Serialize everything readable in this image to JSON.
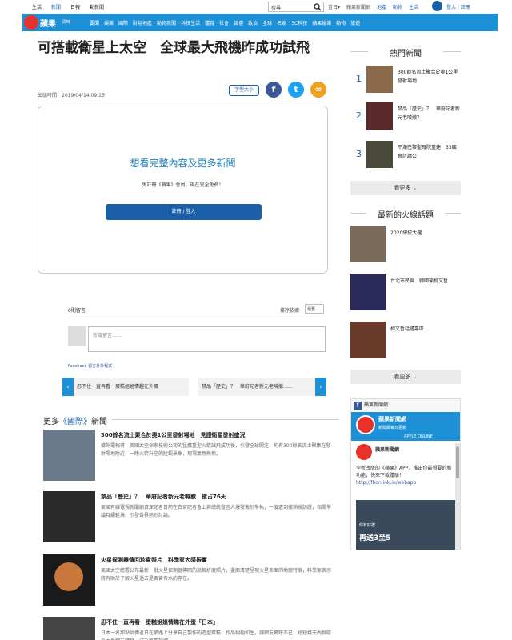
{
  "topbar": {
    "left_links": [
      "生活",
      "新聞",
      "日報",
      "動新聞"
    ],
    "search_placeholder": "搜尋",
    "right_links": [
      {
        "label": "昔日▾",
        "color": "gray"
      },
      {
        "label": "蘋果新聞網",
        "color": "gray"
      },
      {
        "label": "地產",
        "color": "blue"
      },
      {
        "label": "動物",
        "color": "blue"
      },
      {
        "label": "生活",
        "color": "blue"
      }
    ],
    "login": "登入 | 註冊"
  },
  "navbar": {
    "logo": "蘋果",
    "logo_sub": "即時",
    "items": [
      "要聞",
      "娛樂",
      "國際",
      "財經地產",
      "動物新聞",
      "科技生活",
      "體育",
      "社會",
      "論壇",
      "政治",
      "全球",
      "名家",
      "3C科技",
      "蘋果娛樂",
      "動物",
      "旅遊"
    ]
  },
  "article": {
    "title": "可搭載衛星上太空　全球最大飛機昨成功試飛",
    "pubdate": "出版時間：2019/04/14 09:15",
    "font_button": "字型大小",
    "share_icons": [
      "facebook-icon",
      "twitter-icon",
      "link-icon"
    ]
  },
  "paywall": {
    "heading": "想看完整內容及更多新聞",
    "subtext": "免註冊《蘋果》會員，現在完全免費！",
    "button": "註冊 / 登入"
  },
  "comments": {
    "heading": "0則留言",
    "sort_label": "排序依據",
    "sort_value": "最舊",
    "placeholder": "新增留言……",
    "plugin_label": "Facebook 留言外掛程式"
  },
  "prev_next": {
    "prev": "忍不住一直再看　蛋糕姐姐情趣在外蛋",
    "next": "禁品「歷史」？　華府記者新元老喊撤……"
  },
  "more_news": {
    "prefix": "更多",
    "highlight": "《國際》",
    "suffix": "新聞",
    "items": [
      {
        "title": "300餘名流士聚合於奧1公里發射場地　見證衛星發射盛況",
        "summary": "據外電報導，美國太空探索技術公司的猛鷹重型火箭試飛成功後，引發全球關注，約有300餘名流士聚集在發射場地附近，一睹火箭升空的壯觀景象，現場氣氛熱烈。"
      },
      {
        "title": "禁品「歷史」？　華府記者新元老喊撤　搶占76天",
        "summary": "美國有線電視新聞網資深記者日前在白宮記者會上與總統發言人爆發激烈爭執，一度遭到撤銷採訪證，相關爭議持續延燒，引發各界熱烈討論。"
      },
      {
        "title": "火星探測器傳回珍貴照片　科學家大感振奮",
        "summary": "美國太空總署公布最新一批火星探測器傳回的高解析度照片，畫面清楚呈現火星表面的地貌特徵，科學家表示將有助於了解火星過去是否曾有水的存在。"
      },
      {
        "title": "忍不住一直再看　蛋糕姐姐情趣在外蛋「日本」",
        "summary": "日本一名甜點師傅近日在網路上分享自己製作的造型蛋糕，作品栩栩如生，讓網友驚呼不已，短短幾天內就吸引大量網友轉發，成為熱門話題。"
      }
    ]
  },
  "sidebar": {
    "hot_heading": "熱門新聞",
    "hot_items": [
      {
        "num": "1",
        "title": "300餘名流士聚合於奧1公里發射場地"
      },
      {
        "num": "2",
        "title": "禁品「歷史」？　華府記者新元老喊撤？"
      },
      {
        "num": "3",
        "title": "不滿巴黎聖母院重建　33國會討論公"
      }
    ],
    "more_label": "看更多",
    "fire_heading": "最新的火線話題",
    "fire_items": [
      {
        "title": "2020總統大選"
      },
      {
        "title": "台北市民與　韓國瑜柯文哲"
      },
      {
        "title": "柯文哲話題專區"
      }
    ],
    "more_label2": "看更多"
  },
  "fb_widget": {
    "header": "蘋果新聞網",
    "cover_title": "蘋果新聞網",
    "cover_sub": "新聞網每日更新",
    "cover_sub2": "APPLE ONLINE",
    "page_name": "蘋果新聞網",
    "post_text": "全新改版的《蘋果》APP，推出你最想要的新功能，快來下載體驗！",
    "post_link": "http://fbonlink.io/webapp",
    "img_text": "再送3至5",
    "img_text2": "你有好禮"
  },
  "colors": {
    "nav_blue": "#1e90d6",
    "link_blue": "#1a5fa8",
    "brand_red": "#e8312a",
    "facebook": "#3b5998",
    "twitter": "#1da1f2"
  }
}
